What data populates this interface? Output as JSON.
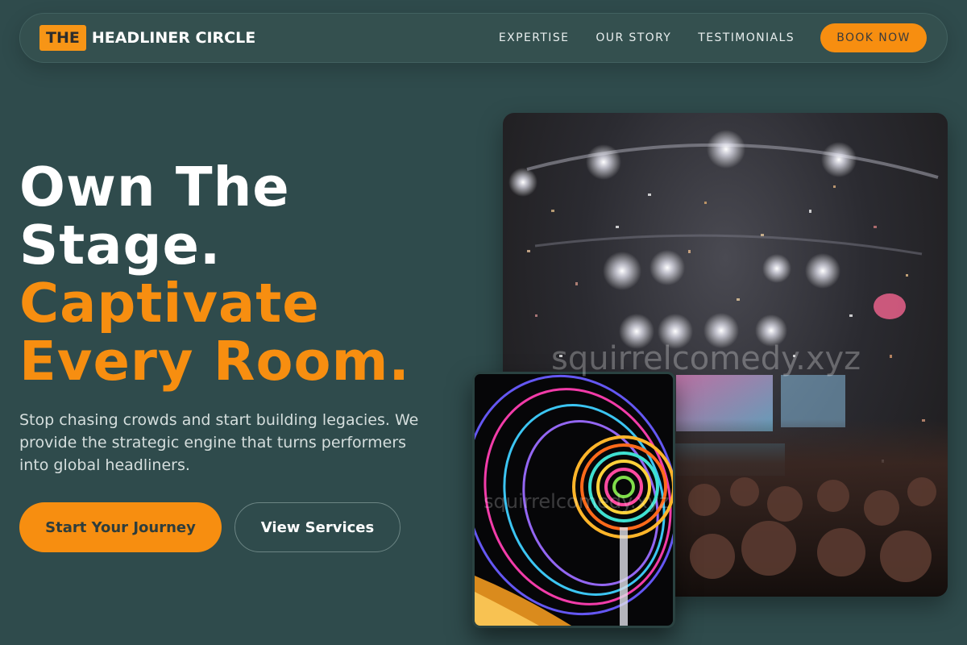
{
  "nav": {
    "logo_badge": "THE",
    "logo_text": "HEADLINER CIRCLE",
    "links": [
      "EXPERTISE",
      "OUR STORY",
      "TESTIMONIALS"
    ],
    "cta": "BOOK NOW"
  },
  "hero": {
    "headline_white": [
      "Own The",
      "Stage."
    ],
    "headline_orange": [
      "Captivate",
      "Every Room."
    ],
    "subtext": "Stop chasing crowds and start building legacies. We provide the strategic engine that turns performers into global headliners.",
    "primary_cta": "Start Your Journey",
    "secondary_cta": "View Services"
  },
  "images": {
    "main": "concert-crowd-photo",
    "inset": "ferris-wheel-light-trails-photo"
  },
  "watermark": "squirrelcomedy.xyz",
  "colors": {
    "background": "#2f4b4c",
    "accent": "#f78e10",
    "text": "#ffffff"
  }
}
